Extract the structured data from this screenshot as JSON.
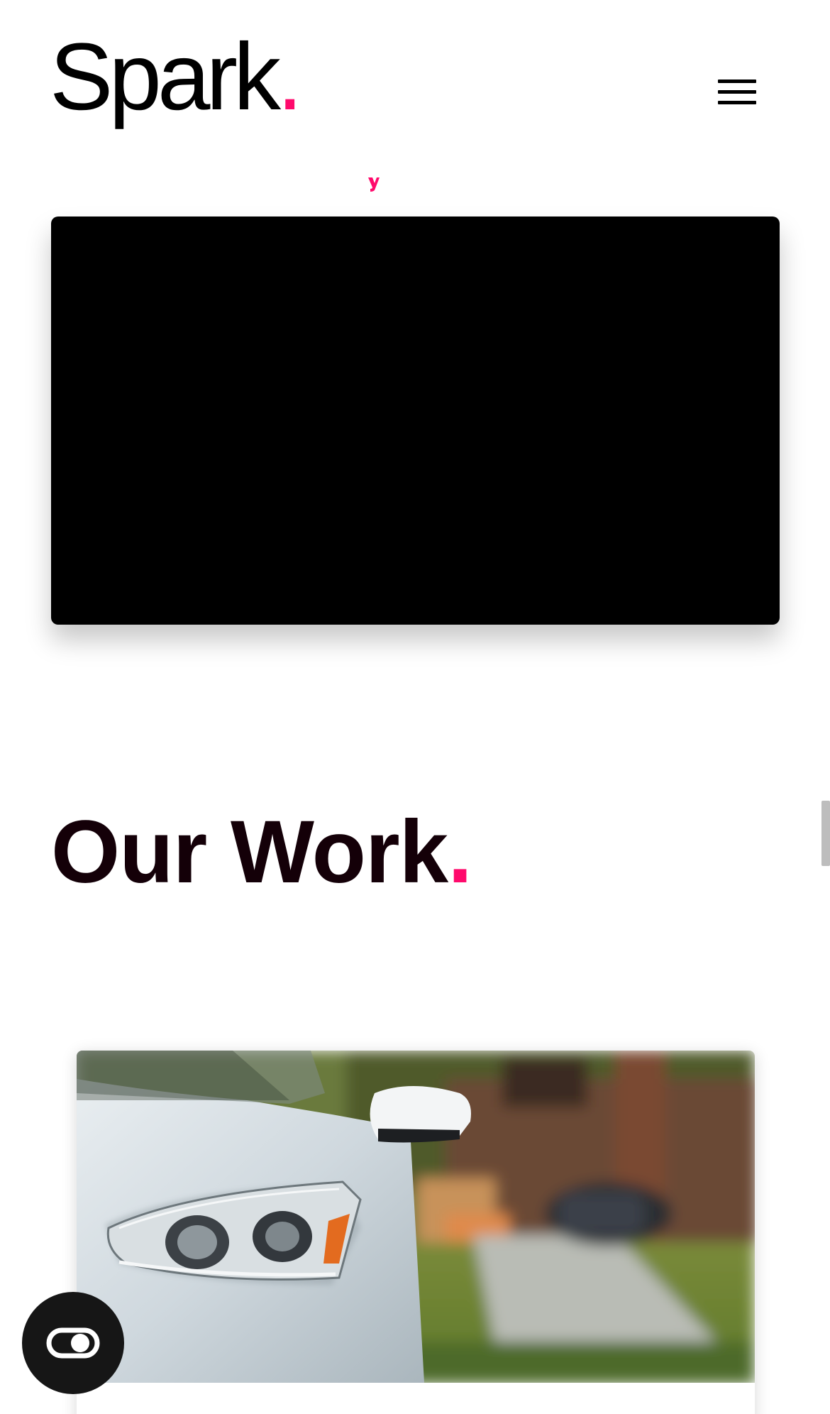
{
  "header": {
    "logo_text": "Spark",
    "logo_dot": ".",
    "menu_icon": "hamburger-menu-icon"
  },
  "colors": {
    "accent": "#ff0a6c",
    "text_dark": "#140008",
    "video_bg": "#000000",
    "a11y_button_bg": "#161616"
  },
  "video": {
    "player": "video-player"
  },
  "work_section": {
    "title": "Our Work",
    "title_dot": ".",
    "card_image": "white-car-headlight-image"
  },
  "accessibility": {
    "icon": "accessibility-toggle-icon"
  }
}
